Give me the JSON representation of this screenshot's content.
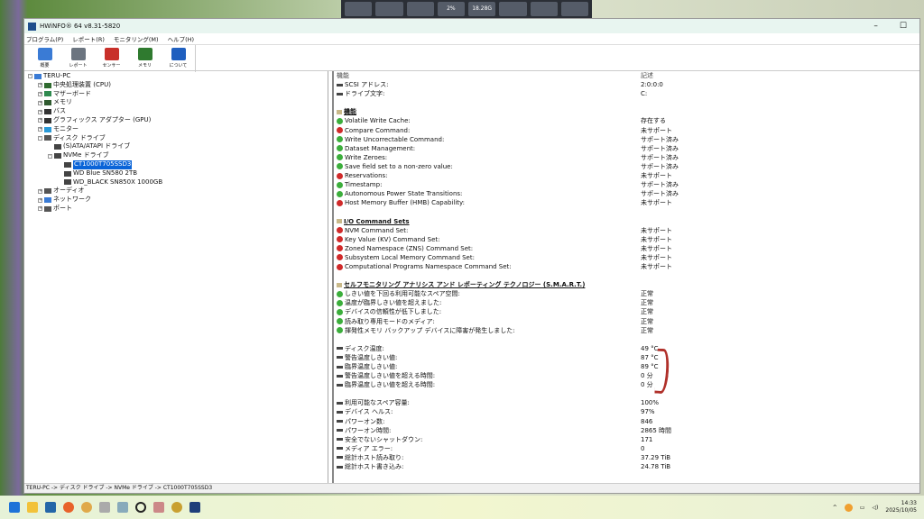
{
  "window": {
    "title": "HWiNFO® 64 v8.31-5820",
    "menu": [
      "プログラム(P)",
      "レポート(R)",
      "モニタリング(M)",
      "ヘルプ(H)"
    ],
    "toolbar": [
      {
        "label": "概要",
        "icon": "computer-icon",
        "color": "#3a7bd5"
      },
      {
        "label": "レポート",
        "icon": "floppy-icon",
        "color": "#6c7580"
      },
      {
        "label": "センサー",
        "icon": "thermometer-icon",
        "color": "#c8302a"
      },
      {
        "label": "メモリ",
        "icon": "memory-icon",
        "color": "#2f7a2f"
      },
      {
        "label": "について",
        "icon": "info-icon",
        "color": "#1f5fbf"
      }
    ]
  },
  "tree": [
    {
      "label": "TERU-PC",
      "level": 0,
      "pm": "-"
    },
    {
      "label": "中央処理装置 (CPU)",
      "level": 1,
      "pm": "+"
    },
    {
      "label": "マザーボード",
      "level": 1,
      "pm": "+"
    },
    {
      "label": "メモリ",
      "level": 1,
      "pm": "+"
    },
    {
      "label": "バス",
      "level": 1,
      "pm": "+"
    },
    {
      "label": "グラフィックス アダプター (GPU)",
      "level": 1,
      "pm": "+"
    },
    {
      "label": "モニター",
      "level": 1,
      "pm": "+"
    },
    {
      "label": "ディスク ドライブ",
      "level": 1,
      "pm": "-"
    },
    {
      "label": "(S)ATA/ATAPI ドライブ",
      "level": 2,
      "pm": ""
    },
    {
      "label": "NVMe ドライブ",
      "level": 2,
      "pm": "-"
    },
    {
      "label": "CT1000T705SSD3",
      "level": 3,
      "pm": "",
      "selected": true
    },
    {
      "label": "WD Blue SN580 2TB",
      "level": 3,
      "pm": ""
    },
    {
      "label": "WD_BLACK SN850X 1000GB",
      "level": 3,
      "pm": ""
    },
    {
      "label": "オーディオ",
      "level": 1,
      "pm": "+"
    },
    {
      "label": "ネットワーク",
      "level": 1,
      "pm": "+"
    },
    {
      "label": "ポート",
      "level": 1,
      "pm": "+"
    }
  ],
  "details": {
    "col_feature": "機能",
    "col_desc": "記述",
    "rows": [
      {
        "t": "drv",
        "label": "SCSI アドレス:",
        "value": "2:0:0:0"
      },
      {
        "t": "drv",
        "label": "ドライブ文字:",
        "value": "C:"
      },
      {
        "t": "blank"
      },
      {
        "t": "sec",
        "label": "機能"
      },
      {
        "t": "ok",
        "label": "Volatile Write Cache:",
        "value": "存在する"
      },
      {
        "t": "err",
        "label": "Compare Command:",
        "value": "未サポート"
      },
      {
        "t": "ok",
        "label": "Write Uncorrectable Command:",
        "value": "サポート済み"
      },
      {
        "t": "ok",
        "label": "Dataset Management:",
        "value": "サポート済み"
      },
      {
        "t": "ok",
        "label": "Write Zeroes:",
        "value": "サポート済み"
      },
      {
        "t": "ok",
        "label": "Save field set to a non-zero value:",
        "value": "サポート済み"
      },
      {
        "t": "err",
        "label": "Reservations:",
        "value": "未サポート"
      },
      {
        "t": "ok",
        "label": "Timestamp:",
        "value": "サポート済み"
      },
      {
        "t": "ok",
        "label": "Autonomous Power State Transitions:",
        "value": "サポート済み"
      },
      {
        "t": "err",
        "label": "Host Memory Buffer (HMB) Capability:",
        "value": "未サポート"
      },
      {
        "t": "blank"
      },
      {
        "t": "sec",
        "label": "I/O Command Sets"
      },
      {
        "t": "err",
        "label": "NVM Command Set:",
        "value": "未サポート"
      },
      {
        "t": "err",
        "label": "Key Value (KV) Command Set:",
        "value": "未サポート"
      },
      {
        "t": "err",
        "label": "Zoned Namespace (ZNS) Command Set:",
        "value": "未サポート"
      },
      {
        "t": "err",
        "label": "Subsystem Local Memory Command Set:",
        "value": "未サポート"
      },
      {
        "t": "err",
        "label": "Computational Programs Namespace Command Set:",
        "value": "未サポート"
      },
      {
        "t": "blank"
      },
      {
        "t": "sec",
        "label": "セルフモニタリング アナリシス アンド レポーティング テクノロジー (S.M.A.R.T.)"
      },
      {
        "t": "ok",
        "label": "しきい値を下回る利用可能なスペア空間:",
        "value": "正常"
      },
      {
        "t": "ok",
        "label": "温度が臨界しきい値を超えました:",
        "value": "正常"
      },
      {
        "t": "ok",
        "label": "デバイスの信頼性が低下しました:",
        "value": "正常"
      },
      {
        "t": "ok",
        "label": "読み取り専用モードのメディア:",
        "value": "正常"
      },
      {
        "t": "ok",
        "label": "揮発性メモリ バックアップ デバイスに障害が発生しました:",
        "value": "正常"
      },
      {
        "t": "blank"
      },
      {
        "t": "drv",
        "label": "ディスク温度:",
        "value": "49 °C"
      },
      {
        "t": "drv",
        "label": "警告温度しきい値:",
        "value": "87 °C"
      },
      {
        "t": "drv",
        "label": "臨界温度しきい値:",
        "value": "89 °C"
      },
      {
        "t": "drv",
        "label": "警告温度しきい値を超える時間:",
        "value": "0 分"
      },
      {
        "t": "drv",
        "label": "臨界温度しきい値を超える時間:",
        "value": "0 分"
      },
      {
        "t": "blank"
      },
      {
        "t": "drv",
        "label": "利用可能なスペア容量:",
        "value": "100%"
      },
      {
        "t": "drv",
        "label": "デバイス ヘルス:",
        "value": "97%"
      },
      {
        "t": "drv",
        "label": "パワーオン数:",
        "value": "846"
      },
      {
        "t": "drv",
        "label": "パワーオン時間:",
        "value": "2865 時間"
      },
      {
        "t": "drv",
        "label": "安全でないシャットダウン:",
        "value": "171"
      },
      {
        "t": "drv",
        "label": "メディア エラー:",
        "value": "0"
      },
      {
        "t": "drv",
        "label": "総計ホスト読み取り:",
        "value": "37.29 TiB"
      },
      {
        "t": "drv",
        "label": "総計ホスト書き込み:",
        "value": "24.78 TiB"
      }
    ]
  },
  "status": "TERU-PC -> ディスク ドライブ -> NVMe ドライブ -> CT1000T705SSD3",
  "topstrip": [
    "",
    "",
    "",
    "2%",
    "18.28G",
    "",
    "",
    ""
  ],
  "taskbar": {
    "time": "14:33",
    "date": "2025/10/05"
  }
}
